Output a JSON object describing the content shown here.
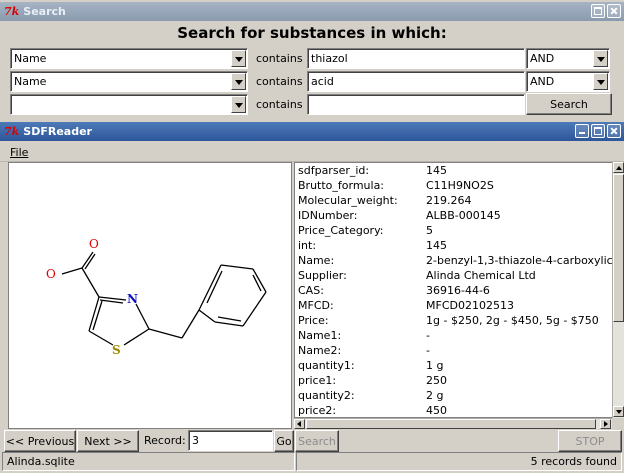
{
  "search_window": {
    "title": "Search",
    "heading": "Search for substances in which:",
    "rows": [
      {
        "field": "Name",
        "op_label": "contains",
        "value": "thiazol",
        "logic": "AND"
      },
      {
        "field": "Name",
        "op_label": "contains",
        "value": "acid",
        "logic": "AND"
      },
      {
        "field": "",
        "op_label": "contains",
        "value": ""
      }
    ],
    "search_button": "Search"
  },
  "main_window": {
    "title": "SDFReader",
    "menu": {
      "file": "File"
    },
    "molecule": {
      "atoms": [
        "O",
        "O",
        "N",
        "S"
      ],
      "colors": {
        "oxygen": "#e00000",
        "nitrogen": "#1010c0",
        "sulfur": "#a08c00",
        "bond": "#000000"
      }
    },
    "properties": [
      {
        "key": "sdfparser_id:",
        "value": "145"
      },
      {
        "key": "Brutto_formula:",
        "value": "C11H9NO2S"
      },
      {
        "key": "Molecular_weight:",
        "value": "219.264"
      },
      {
        "key": "IDNumber:",
        "value": "ALBB-000145"
      },
      {
        "key": "Price_Category:",
        "value": "5"
      },
      {
        "key": "int:",
        "value": "145"
      },
      {
        "key": "Name:",
        "value": "2-benzyl-1,3-thiazole-4-carboxylic"
      },
      {
        "key": "Supplier:",
        "value": "Alinda Chemical Ltd"
      },
      {
        "key": "CAS:",
        "value": "36916-44-6"
      },
      {
        "key": "MFCD:",
        "value": "MFCD02102513"
      },
      {
        "key": "Price:",
        "value": "1g - $250, 2g - $450, 5g - $750"
      },
      {
        "key": "Name1:",
        "value": "-"
      },
      {
        "key": "Name2:",
        "value": "-"
      },
      {
        "key": "quantity1:",
        "value": "1 g"
      },
      {
        "key": "price1:",
        "value": "250"
      },
      {
        "key": "quantity2:",
        "value": "2 g"
      },
      {
        "key": "price2:",
        "value": "450"
      }
    ],
    "nav": {
      "previous": "<< Previous",
      "next": "Next >>",
      "record_label": "Record:",
      "record_value": "3",
      "go": "Go",
      "search": "Search",
      "stop": "STOP"
    },
    "status": {
      "database": "Alinda.sqlite",
      "records_found": "5 records found"
    }
  }
}
